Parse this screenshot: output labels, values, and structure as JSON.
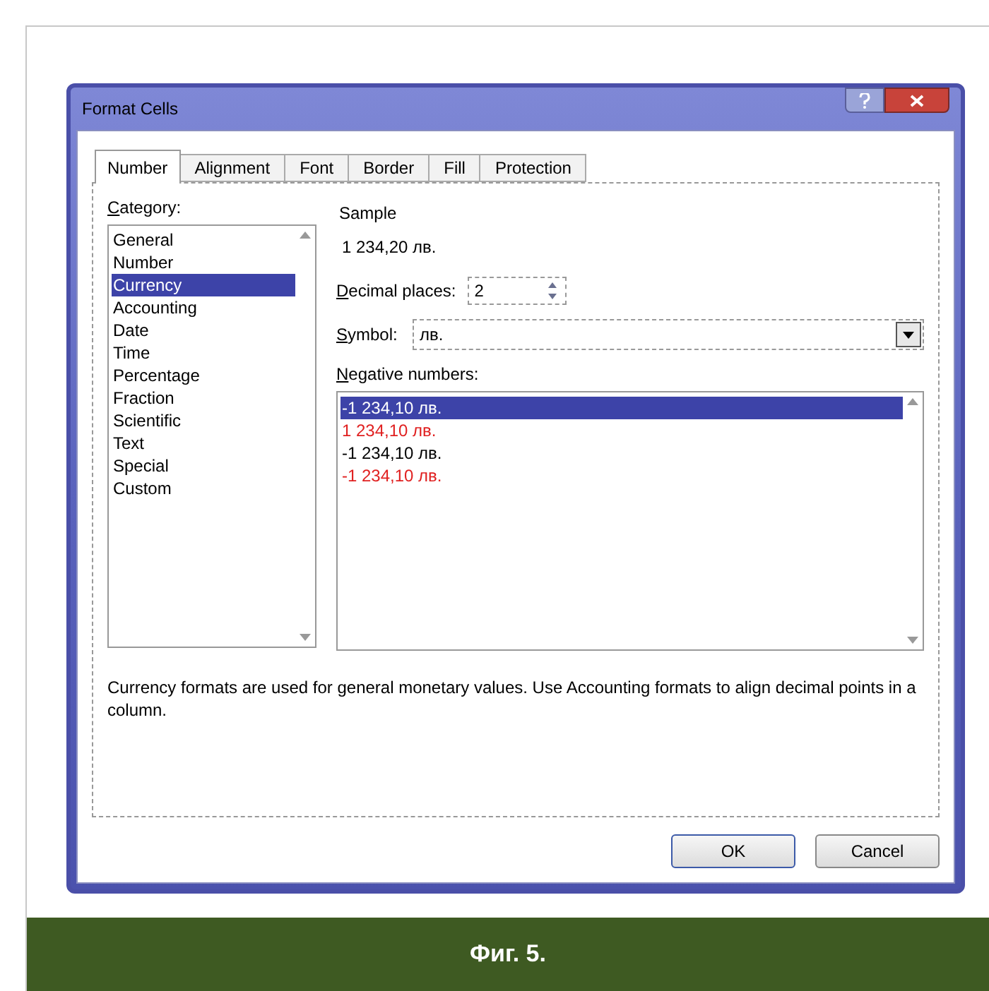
{
  "window": {
    "title": "Format Cells"
  },
  "tabs": [
    {
      "label": "Number",
      "selected": true
    },
    {
      "label": "Alignment",
      "selected": false
    },
    {
      "label": "Font",
      "selected": false
    },
    {
      "label": "Border",
      "selected": false
    },
    {
      "label": "Fill",
      "selected": false
    },
    {
      "label": "Protection",
      "selected": false
    }
  ],
  "category": {
    "label": "Category:",
    "items": [
      {
        "label": "General",
        "selected": false
      },
      {
        "label": "Number",
        "selected": false
      },
      {
        "label": "Currency",
        "selected": true
      },
      {
        "label": "Accounting",
        "selected": false
      },
      {
        "label": "Date",
        "selected": false
      },
      {
        "label": "Time",
        "selected": false
      },
      {
        "label": "Percentage",
        "selected": false
      },
      {
        "label": "Fraction",
        "selected": false
      },
      {
        "label": "Scientific",
        "selected": false
      },
      {
        "label": "Text",
        "selected": false
      },
      {
        "label": "Special",
        "selected": false
      },
      {
        "label": "Custom",
        "selected": false
      }
    ]
  },
  "sample": {
    "label": "Sample",
    "value": "1 234,20 лв."
  },
  "decimal_places": {
    "label": "Decimal places:",
    "value": "2"
  },
  "symbol": {
    "label": "Symbol:",
    "value": "лв."
  },
  "negative_numbers": {
    "label": "Negative numbers:",
    "items": [
      {
        "label": "-1 234,10 лв.",
        "selected": true
      },
      {
        "label": "1 234,10 лв.",
        "color": "#e02020",
        "selected": false
      },
      {
        "label": "-1 234,10 лв.",
        "color": "#000000",
        "selected": false
      },
      {
        "label": "-1 234,10 лв.",
        "color": "#e02020",
        "selected": false
      }
    ]
  },
  "description": "Currency formats are used for general monetary values.  Use Accounting formats to align decimal points in a column.",
  "buttons": [
    "OK",
    "Cancel"
  ],
  "caption": "Фиг. 5."
}
